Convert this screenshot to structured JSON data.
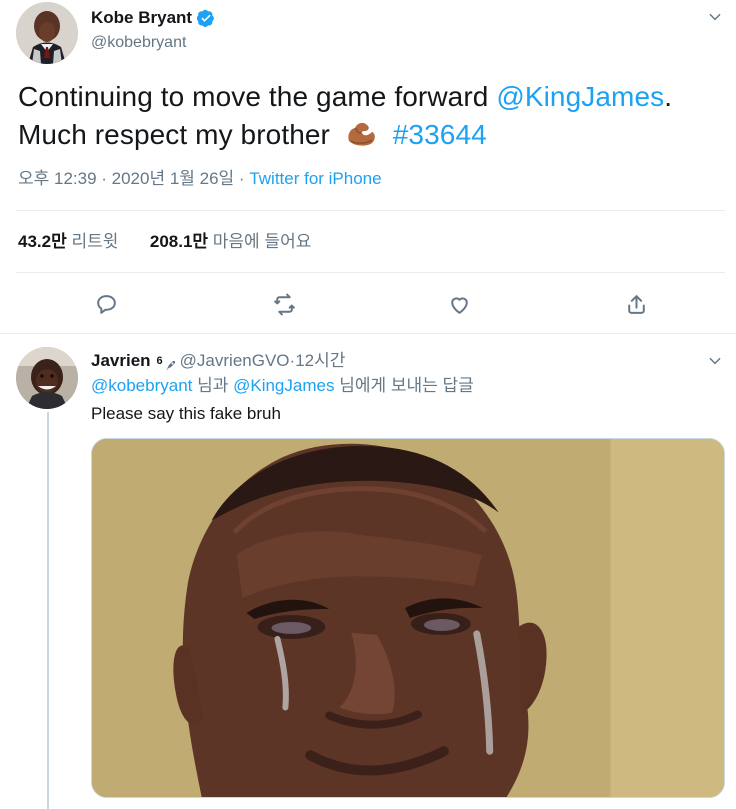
{
  "main_tweet": {
    "author": {
      "display_name": "Kobe Bryant",
      "handle": "@kobebryant",
      "verified": true
    },
    "text": {
      "part1": "Continuing to move the game forward ",
      "mention": "@KingJames",
      "part2": ".",
      "part3": "Much respect my brother",
      "hashtag": "#33644"
    },
    "meta": {
      "timestamp": "오후 12:39 · 2020년 1월 26일 · ",
      "source": "Twitter for iPhone"
    },
    "stats": {
      "retweets_count": "43.2만",
      "retweets_label": "리트윗",
      "likes_count": "208.1만",
      "likes_label": "마음에 들어요"
    },
    "actions": {
      "reply_icon": "reply-icon",
      "retweet_icon": "retweet-icon",
      "like_icon": "heart-icon",
      "share_icon": "share-icon"
    },
    "emoji": "flexed-biceps-icon"
  },
  "reply_tweet": {
    "author": {
      "display_name": "Javrien",
      "badge_text": "6",
      "handle": "@JavrienGVO",
      "separator": " · ",
      "time": "12시간"
    },
    "reply_to": {
      "mention1": "@kobebryant",
      "text1": " 님과 ",
      "mention2": "@KingJames",
      "text2": " 님에게 보내는 답글"
    },
    "text": "Please say this fake bruh",
    "media_icon": "crying-man-image"
  },
  "colors": {
    "link": "#1da1f2",
    "muted": "#657786",
    "text": "#14171a",
    "divider": "#e6ecf0"
  }
}
